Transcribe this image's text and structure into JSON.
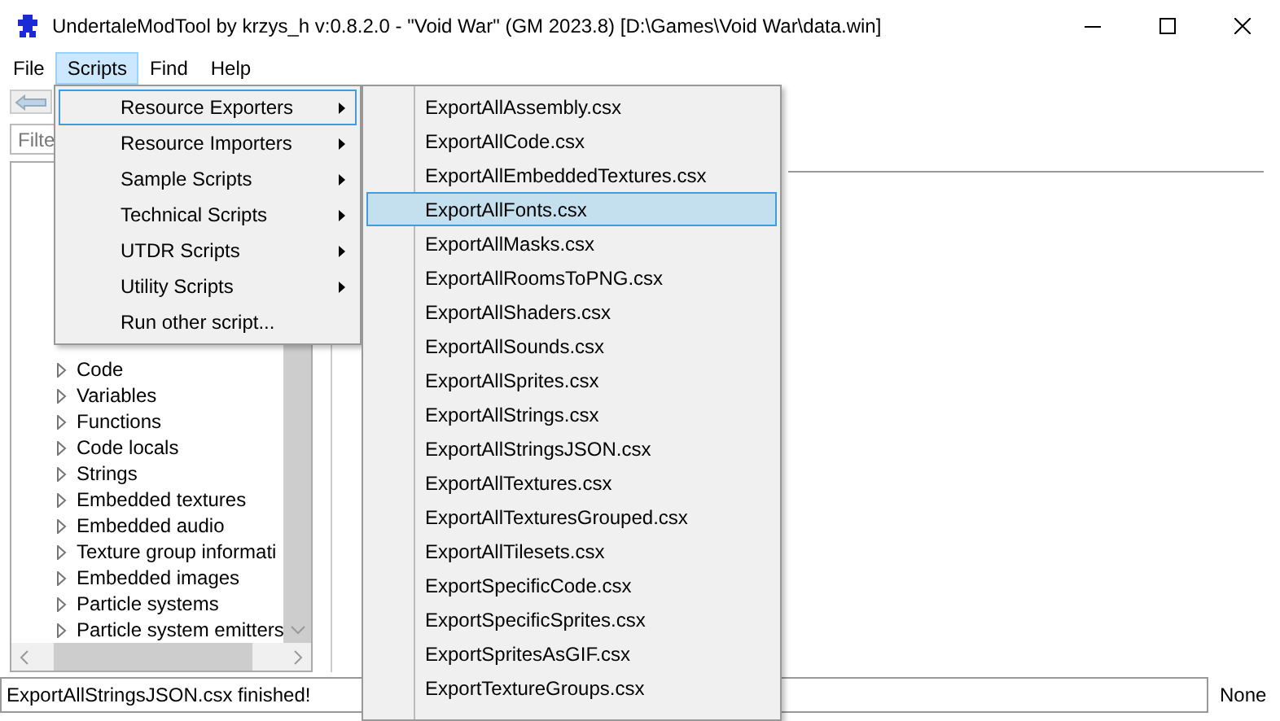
{
  "window": {
    "title": "UndertaleModTool by krzys_h v:0.8.2.0 - \"Void War\" (GM 2023.8) [D:\\Games\\Void War\\data.win]"
  },
  "menubar": [
    {
      "label": "File",
      "selected": false
    },
    {
      "label": "Scripts",
      "selected": true
    },
    {
      "label": "Find",
      "selected": false
    },
    {
      "label": "Help",
      "selected": false
    }
  ],
  "filter": {
    "placeholder": "Filte"
  },
  "tree": {
    "items": [
      {
        "label": "Code"
      },
      {
        "label": "Variables"
      },
      {
        "label": "Functions"
      },
      {
        "label": "Code locals"
      },
      {
        "label": "Strings"
      },
      {
        "label": "Embedded textures"
      },
      {
        "label": "Embedded audio"
      },
      {
        "label": "Texture group informati"
      },
      {
        "label": "Embedded images"
      },
      {
        "label": "Particle systems"
      },
      {
        "label": "Particle system emitters"
      }
    ]
  },
  "scripts_menu": {
    "items": [
      {
        "label": "Resource Exporters",
        "submenu": true,
        "selected": true
      },
      {
        "label": "Resource Importers",
        "submenu": true,
        "selected": false
      },
      {
        "label": "Sample Scripts",
        "submenu": true,
        "selected": false
      },
      {
        "label": "Technical Scripts",
        "submenu": true,
        "selected": false
      },
      {
        "label": "UTDR Scripts",
        "submenu": true,
        "selected": false
      },
      {
        "label": "Utility Scripts",
        "submenu": true,
        "selected": false
      },
      {
        "label": "Run other script...",
        "submenu": false,
        "selected": false
      }
    ]
  },
  "exporters_submenu": {
    "items": [
      {
        "label": "ExportAllAssembly.csx",
        "selected": false
      },
      {
        "label": "ExportAllCode.csx",
        "selected": false
      },
      {
        "label": "ExportAllEmbeddedTextures.csx",
        "selected": false
      },
      {
        "label": "ExportAllFonts.csx",
        "selected": true
      },
      {
        "label": "ExportAllMasks.csx",
        "selected": false
      },
      {
        "label": "ExportAllRoomsToPNG.csx",
        "selected": false
      },
      {
        "label": "ExportAllShaders.csx",
        "selected": false
      },
      {
        "label": "ExportAllSounds.csx",
        "selected": false
      },
      {
        "label": "ExportAllSprites.csx",
        "selected": false
      },
      {
        "label": "ExportAllStrings.csx",
        "selected": false
      },
      {
        "label": "ExportAllStringsJSON.csx",
        "selected": false
      },
      {
        "label": "ExportAllTextures.csx",
        "selected": false
      },
      {
        "label": "ExportAllTexturesGrouped.csx",
        "selected": false
      },
      {
        "label": "ExportAllTilesets.csx",
        "selected": false
      },
      {
        "label": "ExportSpecificCode.csx",
        "selected": false
      },
      {
        "label": "ExportSpecificSprites.csx",
        "selected": false
      },
      {
        "label": "ExportSpritesAsGIF.csx",
        "selected": false
      },
      {
        "label": "ExportTextureGroups.csx",
        "selected": false
      }
    ]
  },
  "status_bar": {
    "message": "ExportAllStringsJSON.csx finished!",
    "right": "None"
  }
}
